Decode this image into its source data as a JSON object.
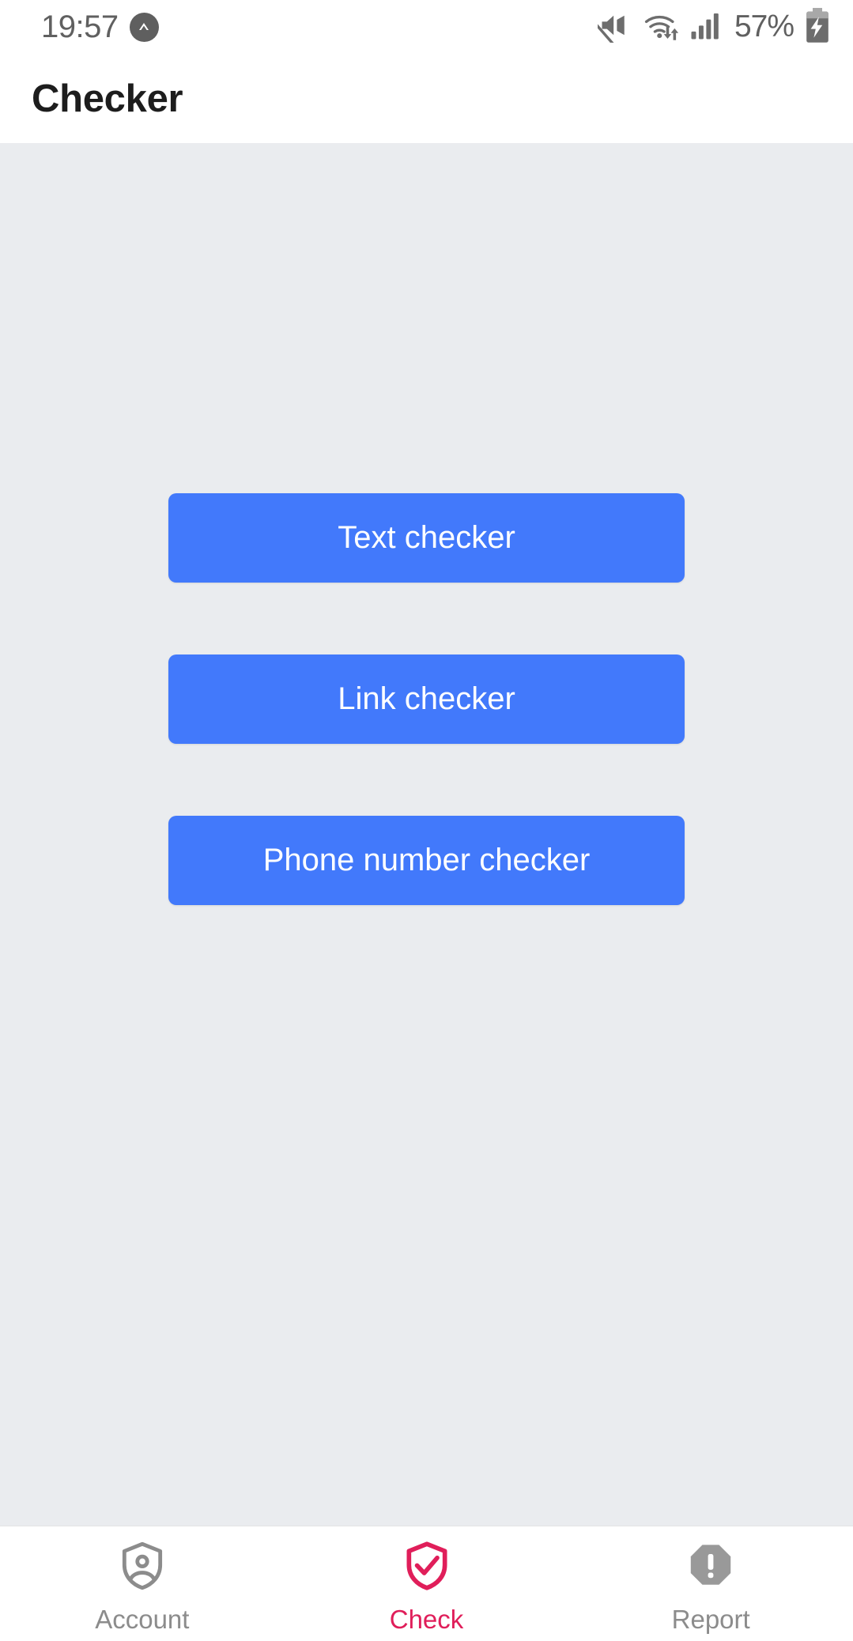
{
  "status_bar": {
    "time": "19:57",
    "app_badge_icon": "chevron-up-circle-icon",
    "icons": [
      "volume-mute-icon",
      "wifi-data-transfer-icon",
      "cellular-signal-icon"
    ],
    "battery_percent": "57%",
    "battery_icon": "battery-charging-icon"
  },
  "app_bar": {
    "title": "Checker"
  },
  "main": {
    "buttons": [
      {
        "label": "Text checker"
      },
      {
        "label": "Link checker"
      },
      {
        "label": "Phone number checker"
      }
    ]
  },
  "bottom_nav": {
    "items": [
      {
        "label": "Account",
        "icon": "shield-person-icon",
        "active": false
      },
      {
        "label": "Check",
        "icon": "shield-check-icon",
        "active": true
      },
      {
        "label": "Report",
        "icon": "octagon-exclamation-icon",
        "active": false
      }
    ]
  },
  "colors": {
    "primary_button": "#4279fb",
    "accent_active": "#e01e5a",
    "content_background": "#eaecef",
    "status_text": "#606060",
    "nav_inactive": "#8c8c8c"
  }
}
